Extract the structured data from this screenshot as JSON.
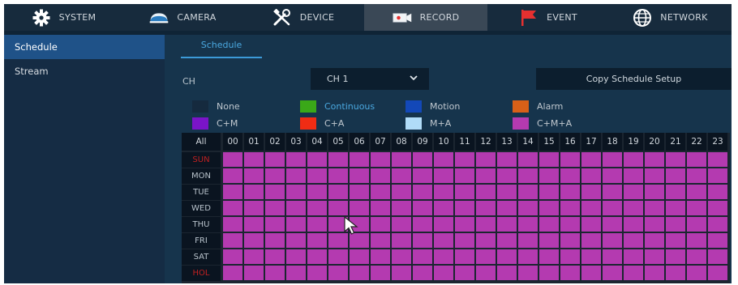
{
  "nav": [
    {
      "label": "SYSTEM",
      "icon": "gear-icon"
    },
    {
      "label": "CAMERA",
      "icon": "camera-icon"
    },
    {
      "label": "DEVICE",
      "icon": "tools-icon"
    },
    {
      "label": "RECORD",
      "icon": "record-icon",
      "active": true
    },
    {
      "label": "EVENT",
      "icon": "flag-icon"
    },
    {
      "label": "NETWORK",
      "icon": "globe-icon"
    }
  ],
  "sidebar": {
    "items": [
      {
        "label": "Schedule",
        "active": true
      },
      {
        "label": "Stream",
        "active": false
      }
    ]
  },
  "main": {
    "subtab": "Schedule",
    "ch_label": "CH",
    "ch_value": "CH 1",
    "copy_label": "Copy Schedule Setup"
  },
  "legend": [
    {
      "label": "None",
      "color": "#152a3e"
    },
    {
      "label": "Continuous",
      "color": "#3aa818"
    },
    {
      "label": "Motion",
      "color": "#1348b8"
    },
    {
      "label": "Alarm",
      "color": "#d86018"
    },
    {
      "label": "C+M",
      "color": "#7a14c8"
    },
    {
      "label": "C+A",
      "color": "#f02c14"
    },
    {
      "label": "M+A",
      "color": "#b0dcf8"
    },
    {
      "label": "C+M+A",
      "color": "#b43ab0"
    }
  ],
  "grid": {
    "all_label": "All",
    "hours": [
      "00",
      "01",
      "02",
      "03",
      "04",
      "05",
      "06",
      "07",
      "08",
      "09",
      "10",
      "11",
      "12",
      "13",
      "14",
      "15",
      "16",
      "17",
      "18",
      "19",
      "20",
      "21",
      "22",
      "23"
    ],
    "days": [
      {
        "label": "SUN",
        "red": true
      },
      {
        "label": "MON",
        "red": false
      },
      {
        "label": "TUE",
        "red": false
      },
      {
        "label": "WED",
        "red": false
      },
      {
        "label": "THU",
        "red": false
      },
      {
        "label": "FRI",
        "red": false
      },
      {
        "label": "SAT",
        "red": false
      },
      {
        "label": "HOL",
        "red": true
      }
    ],
    "fill_mode": "C+M+A",
    "fill_color": "#b43ab0"
  }
}
